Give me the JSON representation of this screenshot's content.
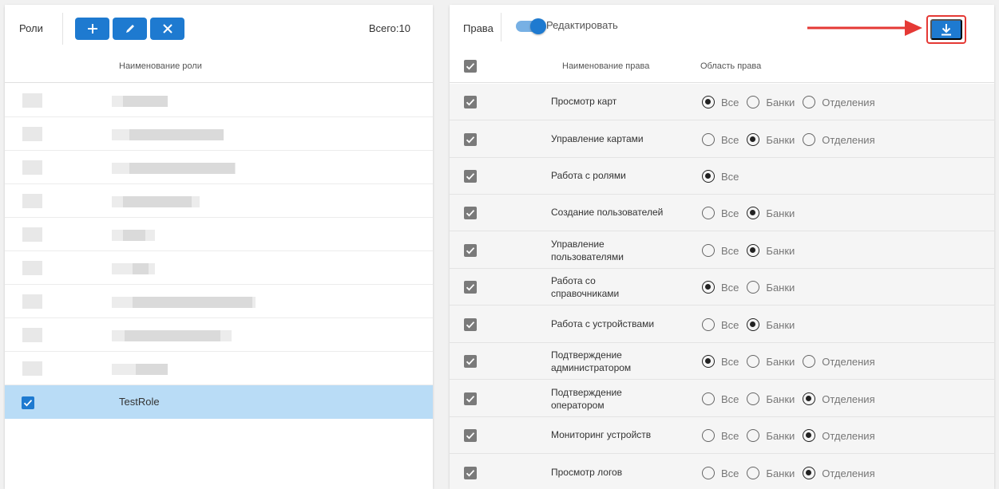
{
  "roles_panel": {
    "title": "Роли",
    "total": "Всего:10",
    "column_header": "Наименование роли",
    "buttons": [
      {
        "name": "add-role-button",
        "icon": "plus-icon"
      },
      {
        "name": "edit-role-button",
        "icon": "pencil-icon"
      },
      {
        "name": "delete-role-button",
        "icon": "close-icon"
      }
    ],
    "selected_role": "TestRole"
  },
  "rights_panel": {
    "title": "Права",
    "edit_toggle_label": "Редактировать",
    "edit_toggle_on": true,
    "download_icon": "download-icon",
    "column_name": "Наименование права",
    "column_scope": "Область права",
    "scope_labels": {
      "all": "Все",
      "banks": "Банки",
      "branches": "Отделения"
    },
    "rows": [
      {
        "name": "Просмотр карт",
        "options": [
          "all",
          "banks",
          "branches"
        ],
        "selected": "all"
      },
      {
        "name": "Управление картами",
        "options": [
          "all",
          "banks",
          "branches"
        ],
        "selected": "banks"
      },
      {
        "name": "Работа с ролями",
        "options": [
          "all"
        ],
        "selected": "all"
      },
      {
        "name": "Создание пользователей",
        "options": [
          "all",
          "banks"
        ],
        "selected": "banks"
      },
      {
        "name": "Управление пользователями",
        "options": [
          "all",
          "banks"
        ],
        "selected": "banks"
      },
      {
        "name": "Работа со справочниками",
        "options": [
          "all",
          "banks"
        ],
        "selected": "all"
      },
      {
        "name": "Работа с устройствами",
        "options": [
          "all",
          "banks"
        ],
        "selected": "banks"
      },
      {
        "name": "Подтверждение администратором",
        "options": [
          "all",
          "banks",
          "branches"
        ],
        "selected": "all"
      },
      {
        "name": "Подтверждение оператором",
        "options": [
          "all",
          "banks",
          "branches"
        ],
        "selected": "branches"
      },
      {
        "name": "Мониторинг устройств",
        "options": [
          "all",
          "banks",
          "branches"
        ],
        "selected": "branches"
      },
      {
        "name": "Просмотр логов",
        "options": [
          "all",
          "banks",
          "branches"
        ],
        "selected": "branches"
      }
    ]
  },
  "colors": {
    "accent": "#1e7ad0",
    "selected_row": "#b9dcf6",
    "highlight": "#e53935"
  }
}
